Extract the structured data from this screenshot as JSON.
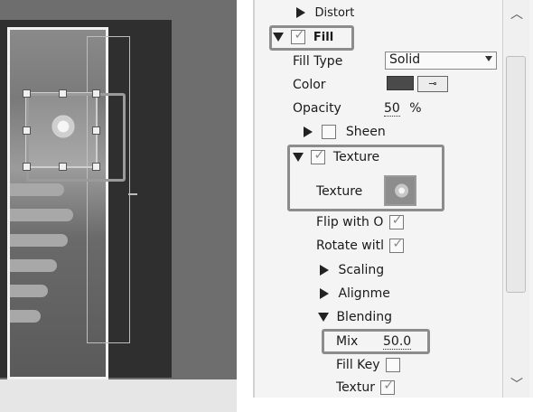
{
  "canvas": {
    "artwork_caption": "Canvas artwork with selected flower object"
  },
  "panel": {
    "distort_label": "Distort",
    "fill_label": "Fill",
    "fill_type_label": "Fill Type",
    "fill_type_value": "Solid",
    "color_label": "Color",
    "color_swatch": "#4a4a4a",
    "opacity_label": "Opacity",
    "opacity_value": "50",
    "opacity_unit": "%",
    "sheen_label": "Sheen",
    "texture_section_label": "Texture",
    "texture_label": "Texture",
    "flip_label": "Flip with O",
    "rotate_label": "Rotate witl",
    "scaling_label": "Scaling",
    "alignment_label": "Alignme",
    "blending_label": "Blending",
    "mix_label": "Mix",
    "mix_value": "50.0",
    "fill_key_label": "Fill Key",
    "textur_label": "Textur",
    "eyedropper_icon": "eyedropper-icon"
  },
  "scrollbar": {
    "up_glyph": "︿",
    "down_glyph": "﹀"
  }
}
